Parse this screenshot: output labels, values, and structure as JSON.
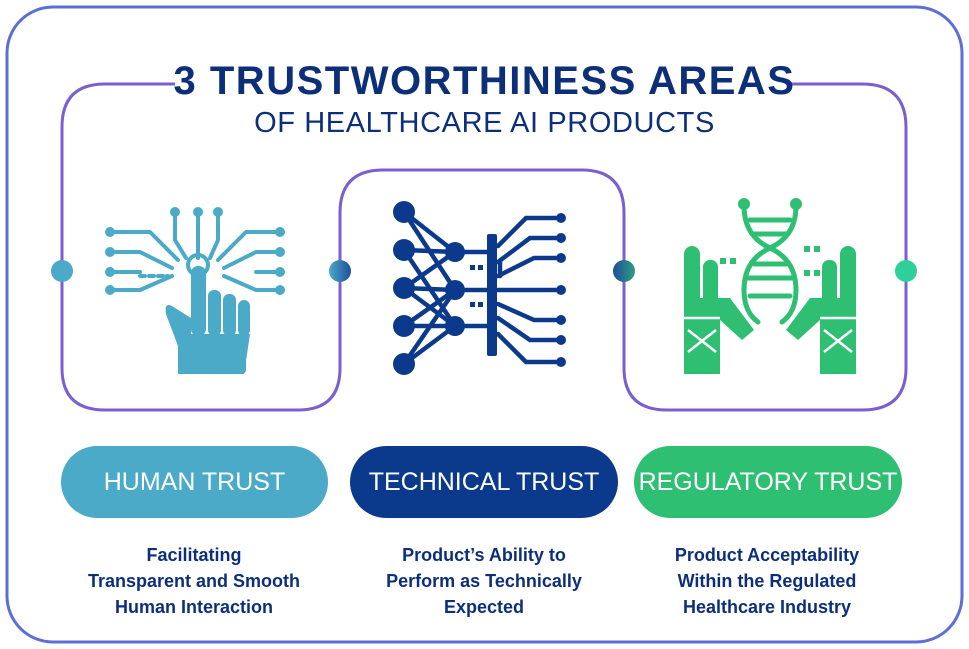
{
  "title": {
    "line1": "3 TRUSTWORTHINESS AREAS",
    "line2": "OF HEALTHCARE AI PRODUCTS"
  },
  "colors": {
    "frame": "#5b6fd6",
    "connector": "#7a5fd0",
    "title": "#0d2f7a",
    "human": "#4aaac8",
    "technical": "#0b3a8c",
    "regulatory": "#2fbf73"
  },
  "areas": [
    {
      "icon": "hand-circuit-icon",
      "label": "HUMAN TRUST",
      "description": [
        "Facilitating",
        "Transparent and Smooth",
        "Human Interaction"
      ]
    },
    {
      "icon": "neural-network-icon",
      "label": "TECHNICAL TRUST",
      "description": [
        "Product’s Ability to",
        "Perform as Technically",
        "Expected"
      ]
    },
    {
      "icon": "dna-hands-icon",
      "label": "REGULATORY TRUST",
      "description": [
        "Product Acceptability",
        "Within the Regulated",
        "Healthcare Industry"
      ]
    }
  ]
}
